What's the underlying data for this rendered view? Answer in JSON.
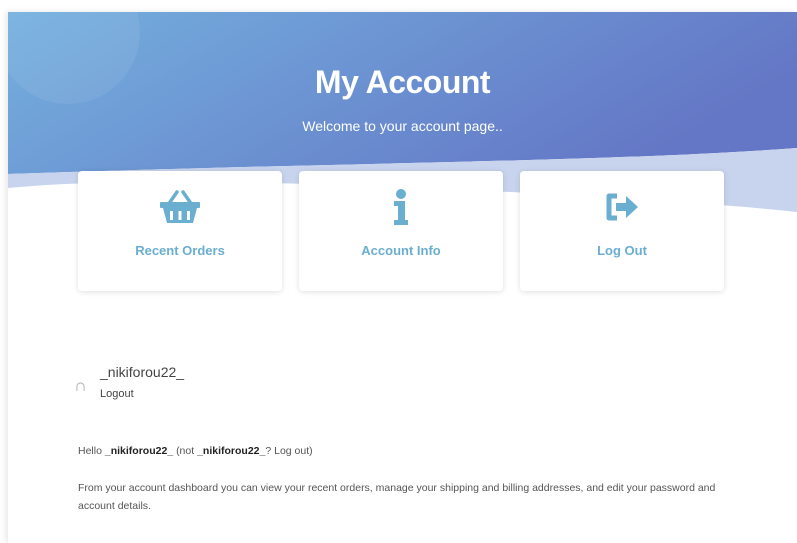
{
  "hero": {
    "title": "My Account",
    "subtitle": "Welcome to your account page..",
    "gradient_start": "#74b0de",
    "gradient_end": "#6477c6",
    "wave_color": "#c8d4ee"
  },
  "cards": [
    {
      "label": "Recent Orders",
      "icon": "basket-icon"
    },
    {
      "label": "Account Info",
      "icon": "info-icon"
    },
    {
      "label": "Log Out",
      "icon": "sign-out-icon"
    }
  ],
  "accent_color": "#6aaed0",
  "user": {
    "username": "_nikiforou22_",
    "logout_label": "Logout"
  },
  "greeting": {
    "hello": "Hello",
    "name": "_nikiforou22_",
    "not_prefix": "(not",
    "not_name": "_nikiforou22_",
    "logout_text": "? Log out)"
  },
  "dashboard_text": "From your account dashboard you can view your recent orders, manage your shipping and billing addresses, and edit your password and account details."
}
